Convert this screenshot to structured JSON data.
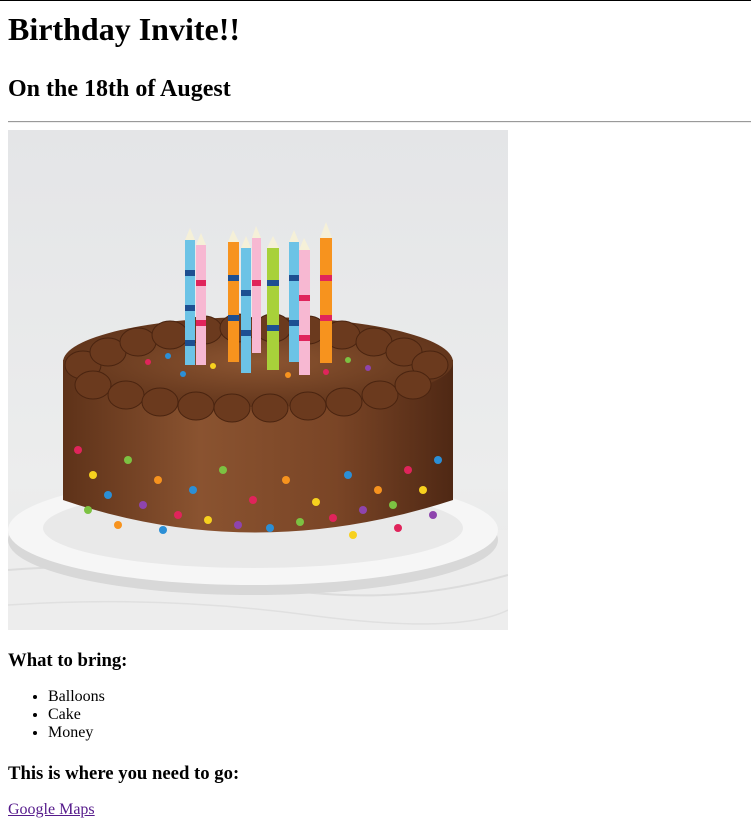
{
  "page": {
    "title": "Birthday Invite!!",
    "subtitle": "On the 18th of Augest"
  },
  "image": {
    "subject": "cake-photo",
    "colors": {
      "background": "#e6e7e9",
      "frosting": "#7a4526",
      "plate": "#f4f4f4"
    }
  },
  "bring": {
    "heading": "What to bring:",
    "items": [
      "Balloons",
      "Cake",
      "Money"
    ]
  },
  "location": {
    "heading": "This is where you need to go:",
    "link_label": "Google Maps",
    "link_color": "#551a8b"
  }
}
